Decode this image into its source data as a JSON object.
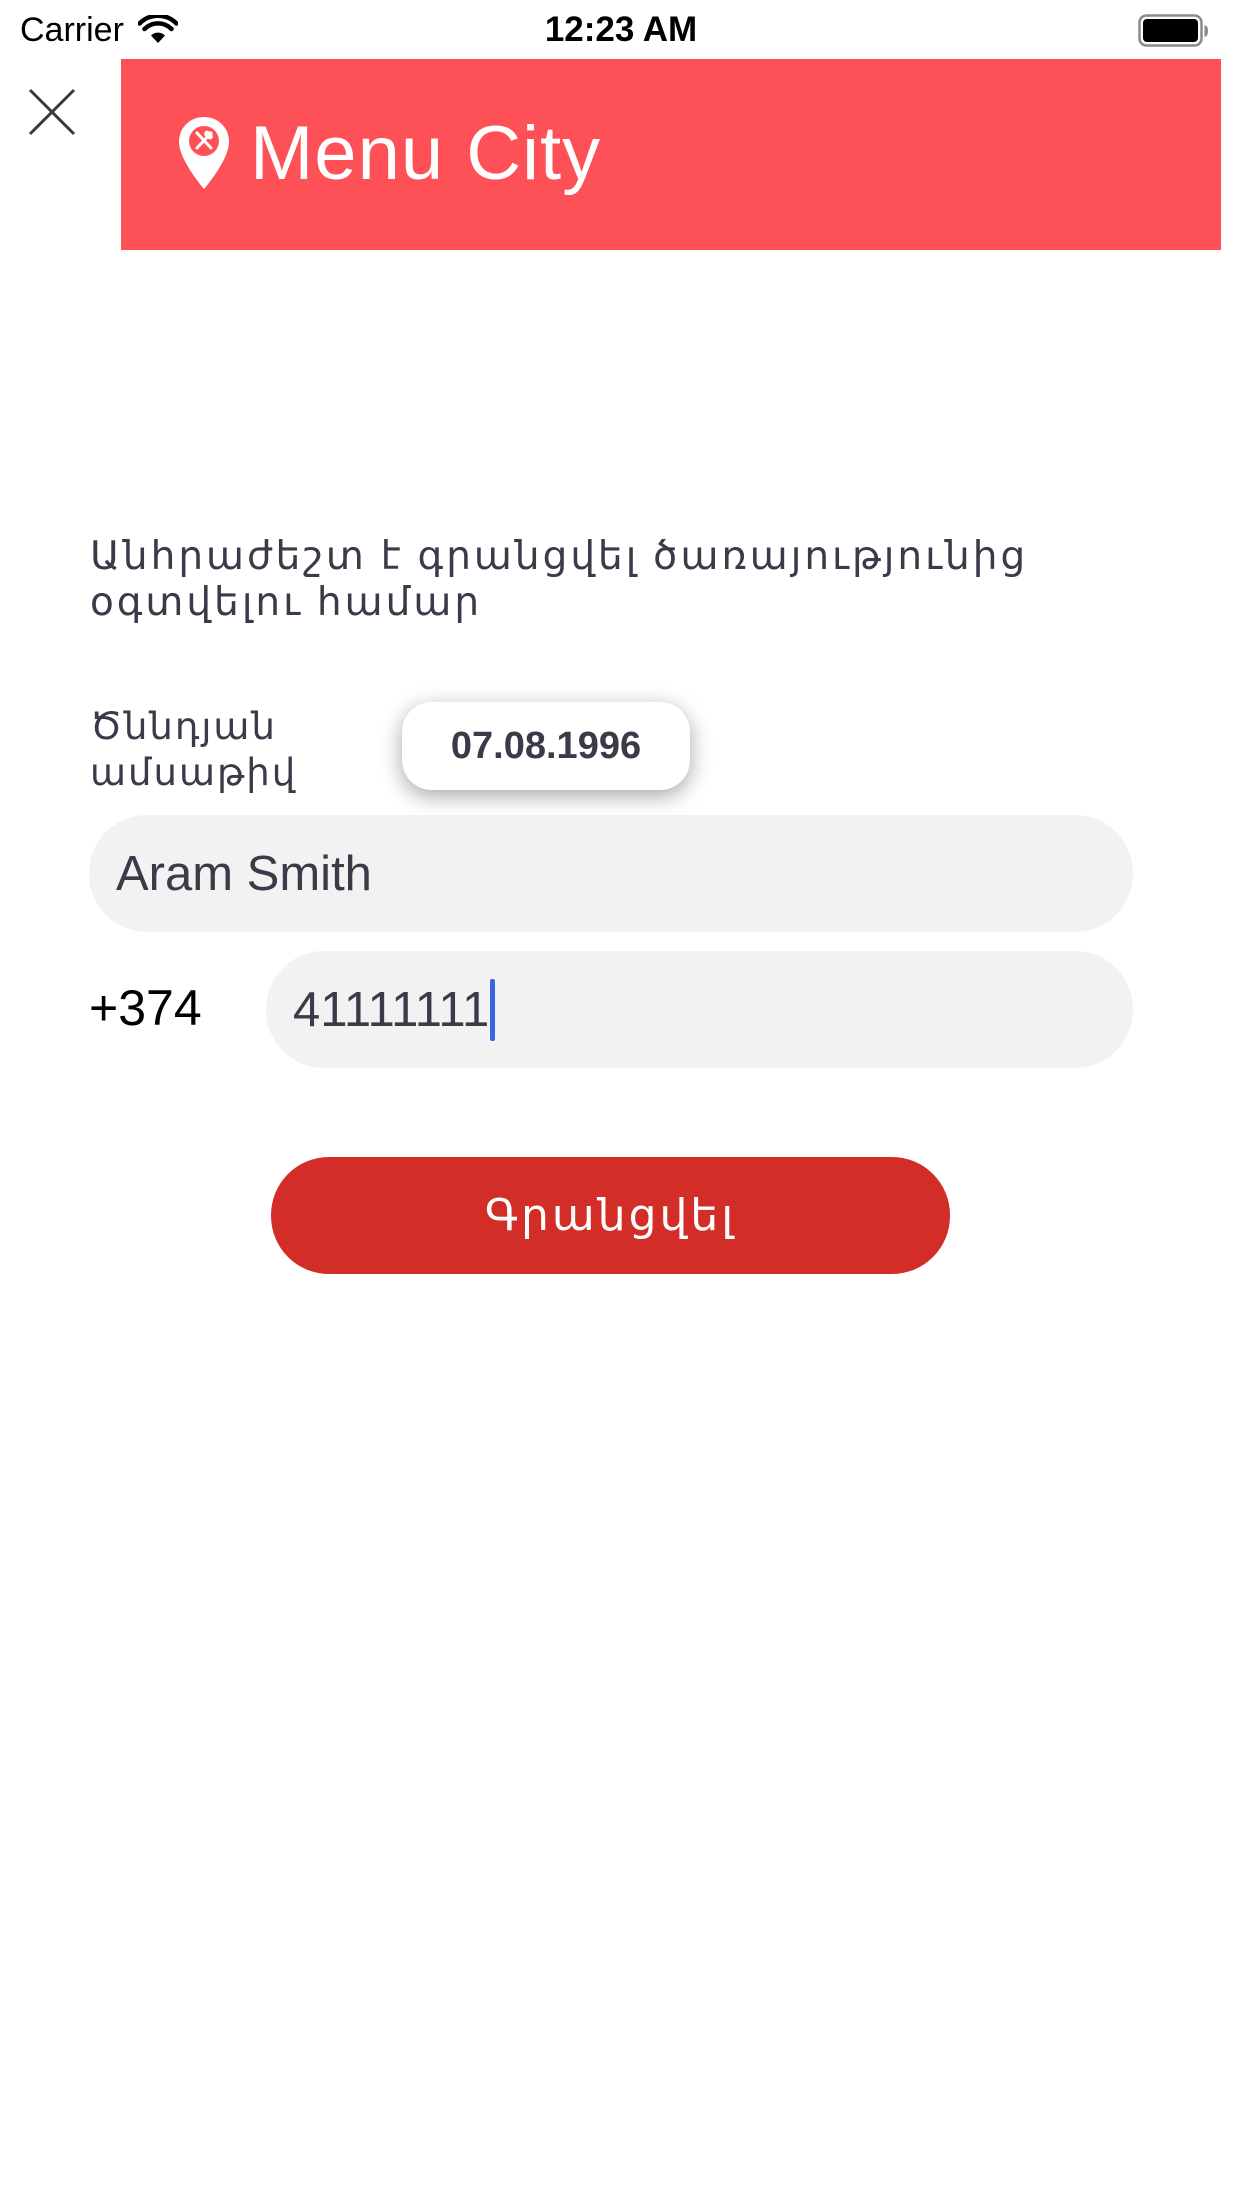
{
  "status_bar": {
    "carrier": "Carrier",
    "time": "12:23 AM",
    "wifi_icon": "wifi-icon",
    "battery_icon": "battery-full-icon"
  },
  "header": {
    "close_icon": "close-icon",
    "brand_name": "Menu City",
    "brand_icon": "map-pin-utensils-icon",
    "banner_color": "#fe5157"
  },
  "form": {
    "intro_text": "Անհրաժեշտ է գրանցվել ծառայությունից օգտվելու համար",
    "birthdate": {
      "label": "Ծննդյան ամսաթիվ",
      "value": "07.08.1996"
    },
    "name": {
      "value": "Aram Smith"
    },
    "phone": {
      "prefix": "+374",
      "value": "41111111"
    },
    "submit": {
      "label": "Գրանցվել",
      "color": "#d22e27"
    }
  }
}
